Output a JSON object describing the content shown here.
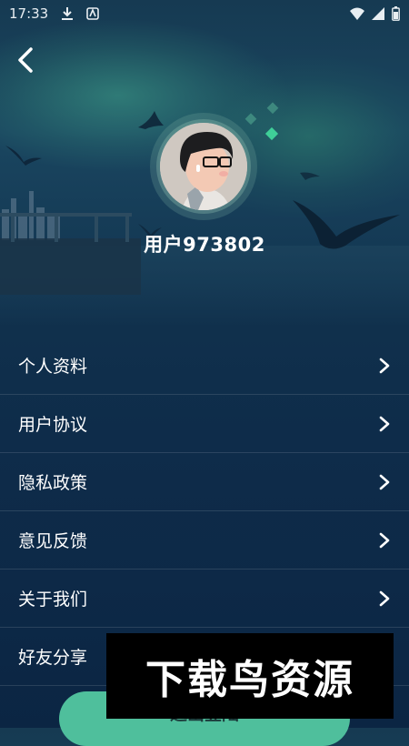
{
  "status_bar": {
    "time": "17:33"
  },
  "profile": {
    "username": "用户973802"
  },
  "menu": {
    "items": [
      {
        "label": "个人资料"
      },
      {
        "label": "用户协议"
      },
      {
        "label": "隐私政策"
      },
      {
        "label": "意见反馈"
      },
      {
        "label": "关于我们"
      },
      {
        "label": "好友分享"
      }
    ]
  },
  "logout_button": {
    "label": "退出登陆"
  },
  "watermark": {
    "text": "下载鸟资源"
  },
  "colors": {
    "accent": "#4fbf9c",
    "background": "#0e2c4a"
  }
}
